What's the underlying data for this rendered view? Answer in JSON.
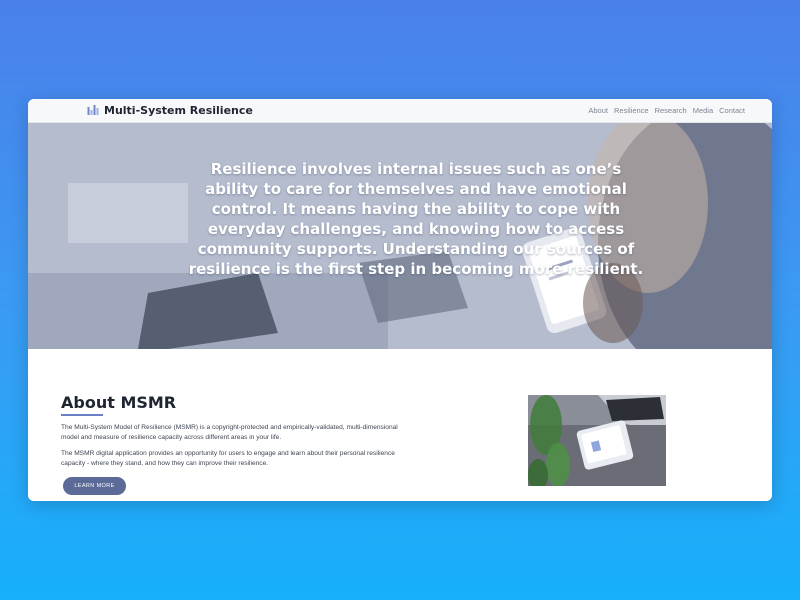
{
  "navbar": {
    "brand": "Multi-System Resilience",
    "links": [
      "About",
      "Resilience",
      "Research",
      "Media",
      "Contact"
    ]
  },
  "hero": {
    "text": "Resilience involves internal issues such as one’s ability to care for themselves and have emotional control. It means having the ability to cope with everyday challenges, and knowing how to access community supports. Understanding our sources of resilience is the first step in becoming more resilient."
  },
  "about": {
    "title": "About MSMR",
    "paragraph1": "The Multi-System Model of Resilience (MSMR) is a copyright-protected and empirically-validated, multi-dimensional model and measure of resilience capacity across different areas in your life.",
    "paragraph2": "The MSMR digital application provides an opportunity for users to engage and learn about their personal resilience capacity - where they stand, and how they can improve their resilience.",
    "button_label": "LEARN MORE"
  },
  "colors": {
    "background_top": "#4a80ea",
    "background_bottom": "#16b0fb",
    "button": "#5b6a97",
    "accent_underline": "#6b7fc9",
    "brand_logo": "#6f86c9"
  },
  "icons": {
    "logo": "bar-chart-logo-icon"
  }
}
